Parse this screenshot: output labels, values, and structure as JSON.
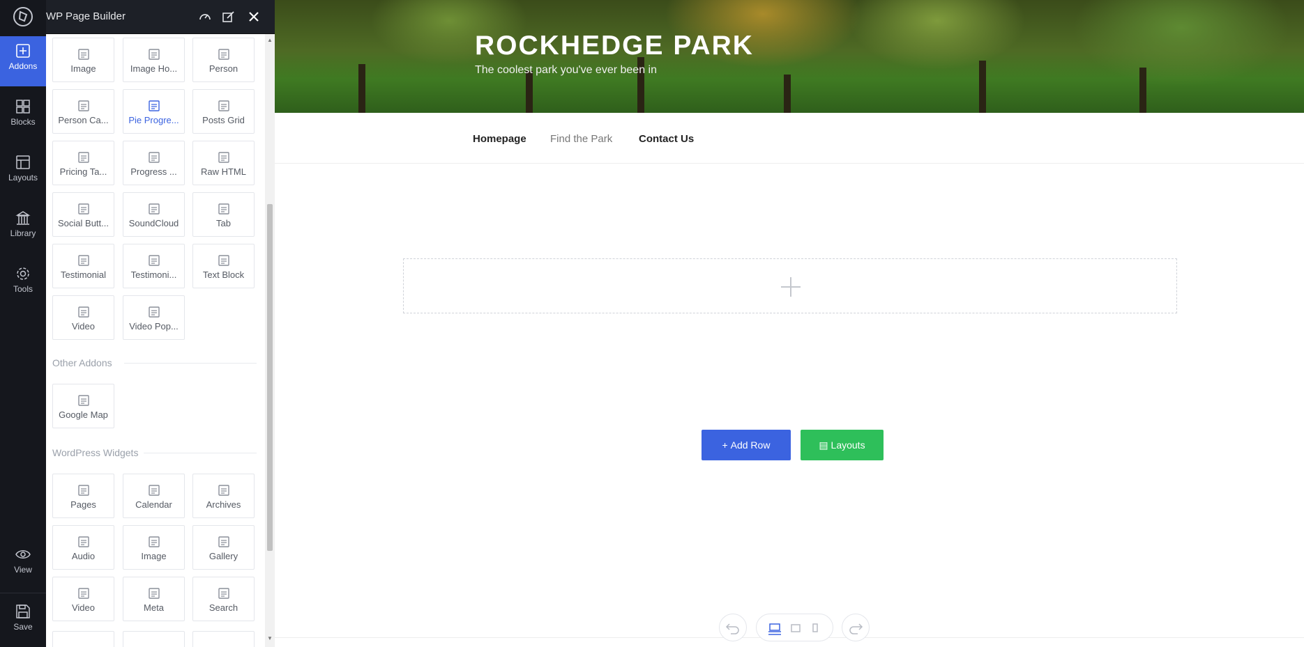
{
  "app": {
    "title": "WP Page Builder"
  },
  "rail": {
    "items": [
      {
        "label": "Addons",
        "icon": "plus-square-icon",
        "active": true
      },
      {
        "label": "Blocks",
        "icon": "blocks-icon"
      },
      {
        "label": "Layouts",
        "icon": "layouts-icon"
      },
      {
        "label": "Library",
        "icon": "library-icon"
      },
      {
        "label": "Tools",
        "icon": "gear-icon"
      }
    ],
    "bottom": [
      {
        "label": "View",
        "icon": "eye-icon"
      },
      {
        "label": "Save",
        "icon": "floppy-icon"
      }
    ]
  },
  "addons": {
    "grid": [
      [
        "Image",
        "Image Ho...",
        "Person"
      ],
      [
        "Person Ca...",
        "Pie Progre...",
        "Posts Grid"
      ],
      [
        "Pricing Ta...",
        "Progress ...",
        "Raw HTML"
      ],
      [
        "Social Butt...",
        "SoundCloud",
        "Tab"
      ],
      [
        "Testimonial",
        "Testimoni...",
        "Text Block"
      ],
      [
        "Video",
        "Video Pop..."
      ]
    ],
    "selected": "Pie Progre...",
    "other_title": "Other Addons",
    "other": [
      "Google Map"
    ],
    "widgets_title": "WordPress Widgets",
    "widgets": [
      [
        "Pages",
        "Calendar",
        "Archives"
      ],
      [
        "Audio",
        "Image",
        "Gallery"
      ],
      [
        "Video",
        "Meta",
        "Search"
      ]
    ]
  },
  "site": {
    "title": "ROCKHEDGE PARK",
    "tagline": "The coolest park you've ever been in",
    "nav": [
      "Homepage",
      "Find the Park",
      "Contact Us"
    ]
  },
  "builder": {
    "add_row": "Add Row",
    "layouts": "Layouts"
  },
  "colors": {
    "accent": "#3b63e0",
    "green": "#2ebf5a",
    "rail": "#15171d"
  }
}
